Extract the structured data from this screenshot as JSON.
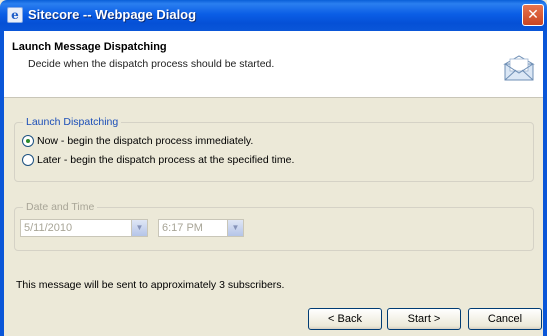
{
  "window": {
    "title": "Sitecore -- Webpage Dialog",
    "close_glyph": "✕"
  },
  "header": {
    "title": "Launch Message Dispatching",
    "subtitle": "Decide when the dispatch process should be started.",
    "icon": "envelope-icon"
  },
  "launch_group": {
    "legend": "Launch Dispatching",
    "options": [
      {
        "label": "Now - begin the dispatch process immediately.",
        "selected": true
      },
      {
        "label": "Later - begin the dispatch process at the specified time.",
        "selected": false
      }
    ]
  },
  "datetime_group": {
    "legend": "Date and Time",
    "date_value": "5/11/2010",
    "time_value": "6:17 PM",
    "disabled": true
  },
  "message": "This message will be sent to approximately 3 subscribers.",
  "buttons": {
    "back": "< Back",
    "start": "Start >",
    "cancel": "Cancel"
  },
  "colors": {
    "titlebar": "#0a56d8",
    "legend_active": "#1c4fb8",
    "disabled_text": "#a8a597"
  }
}
